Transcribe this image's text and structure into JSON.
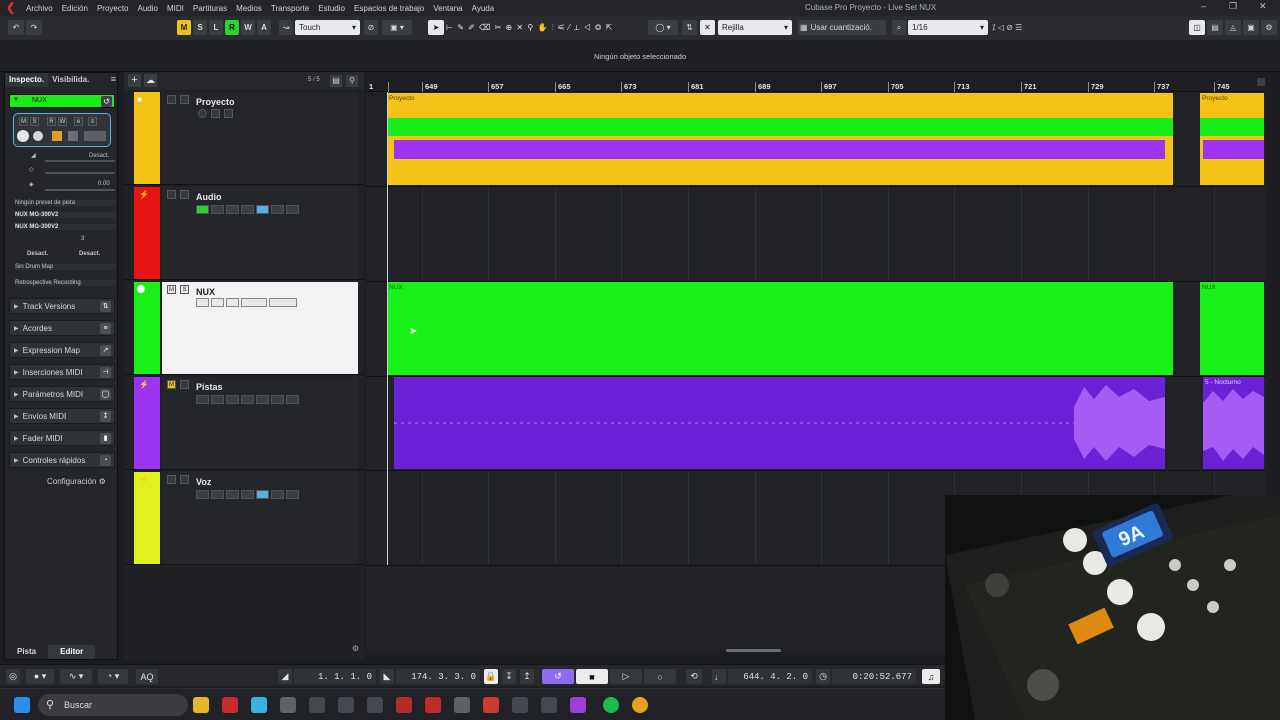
{
  "menubar": {
    "items": [
      "Archivo",
      "Edición",
      "Proyecto",
      "Audio",
      "MIDI",
      "Partituras",
      "Medios",
      "Transporte",
      "Estudio",
      "Espacios de trabajo",
      "Ventana",
      "Ayuda"
    ],
    "title": "Cubase Pro Proyecto - Live Set NUX"
  },
  "toolbar": {
    "msrw": [
      "M",
      "S",
      "L",
      "R",
      "W",
      "A"
    ],
    "automation_mode": "Touch",
    "snap_type": "Rejilla",
    "quantize_mode": "Usar cuantizació.",
    "quantize_value": "1/16"
  },
  "status": {
    "message": "Ningún objeto seleccionado"
  },
  "inspector": {
    "tabs": [
      "Inspecto.",
      "Visibilida."
    ],
    "track_name": "NUX",
    "off_label": "Desact.",
    "pan_value": "0.00",
    "no_preset": "Ningún preset de pista",
    "input": "NUX MG-300V2",
    "output": "NUX MG-300V2",
    "channel": "3",
    "desact_left": "Desact.",
    "desact_right": "Desact.",
    "drum_map": "Sin Drum Map",
    "retro": "Retrospective Recording",
    "sections": [
      "Track Versions",
      "Acordes",
      "Expression Map",
      "Inserciones MIDI",
      "Parámetros MIDI",
      "Envíos MIDI",
      "Fader MIDI",
      "Controles rápidos"
    ],
    "config": "Configuración",
    "bottom_tabs": [
      "Pista",
      "Editor"
    ]
  },
  "tracklist": {
    "counter": "5 / 5",
    "tracks": [
      {
        "name": "Proyecto",
        "color": "#f5c318"
      },
      {
        "name": "Audio",
        "color": "#e81313"
      },
      {
        "name": "NUX",
        "color": "#19f01a"
      },
      {
        "name": "Pistas",
        "color": "#9b33f0"
      },
      {
        "name": "Voz",
        "color": "#dff21d"
      }
    ]
  },
  "ruler": {
    "labels": [
      "1",
      "649",
      "657",
      "665",
      "673",
      "681",
      "689",
      "697",
      "705",
      "713",
      "721",
      "729",
      "737",
      "745"
    ]
  },
  "events": {
    "proyecto": "Proyecto",
    "proyecto2": "Proyecto",
    "nux": "NUX",
    "nux2": "NUX",
    "pistas2": "5 - Nocturno"
  },
  "transport": {
    "left_locator": "1. 1. 1.   0",
    "right_locator": "174. 3. 3.   0",
    "position_bars": "644. 4. 2.   0",
    "position_time": "0:20:52.677"
  },
  "taskbar": {
    "search": "Buscar"
  },
  "webcam": {
    "display": "9A"
  }
}
